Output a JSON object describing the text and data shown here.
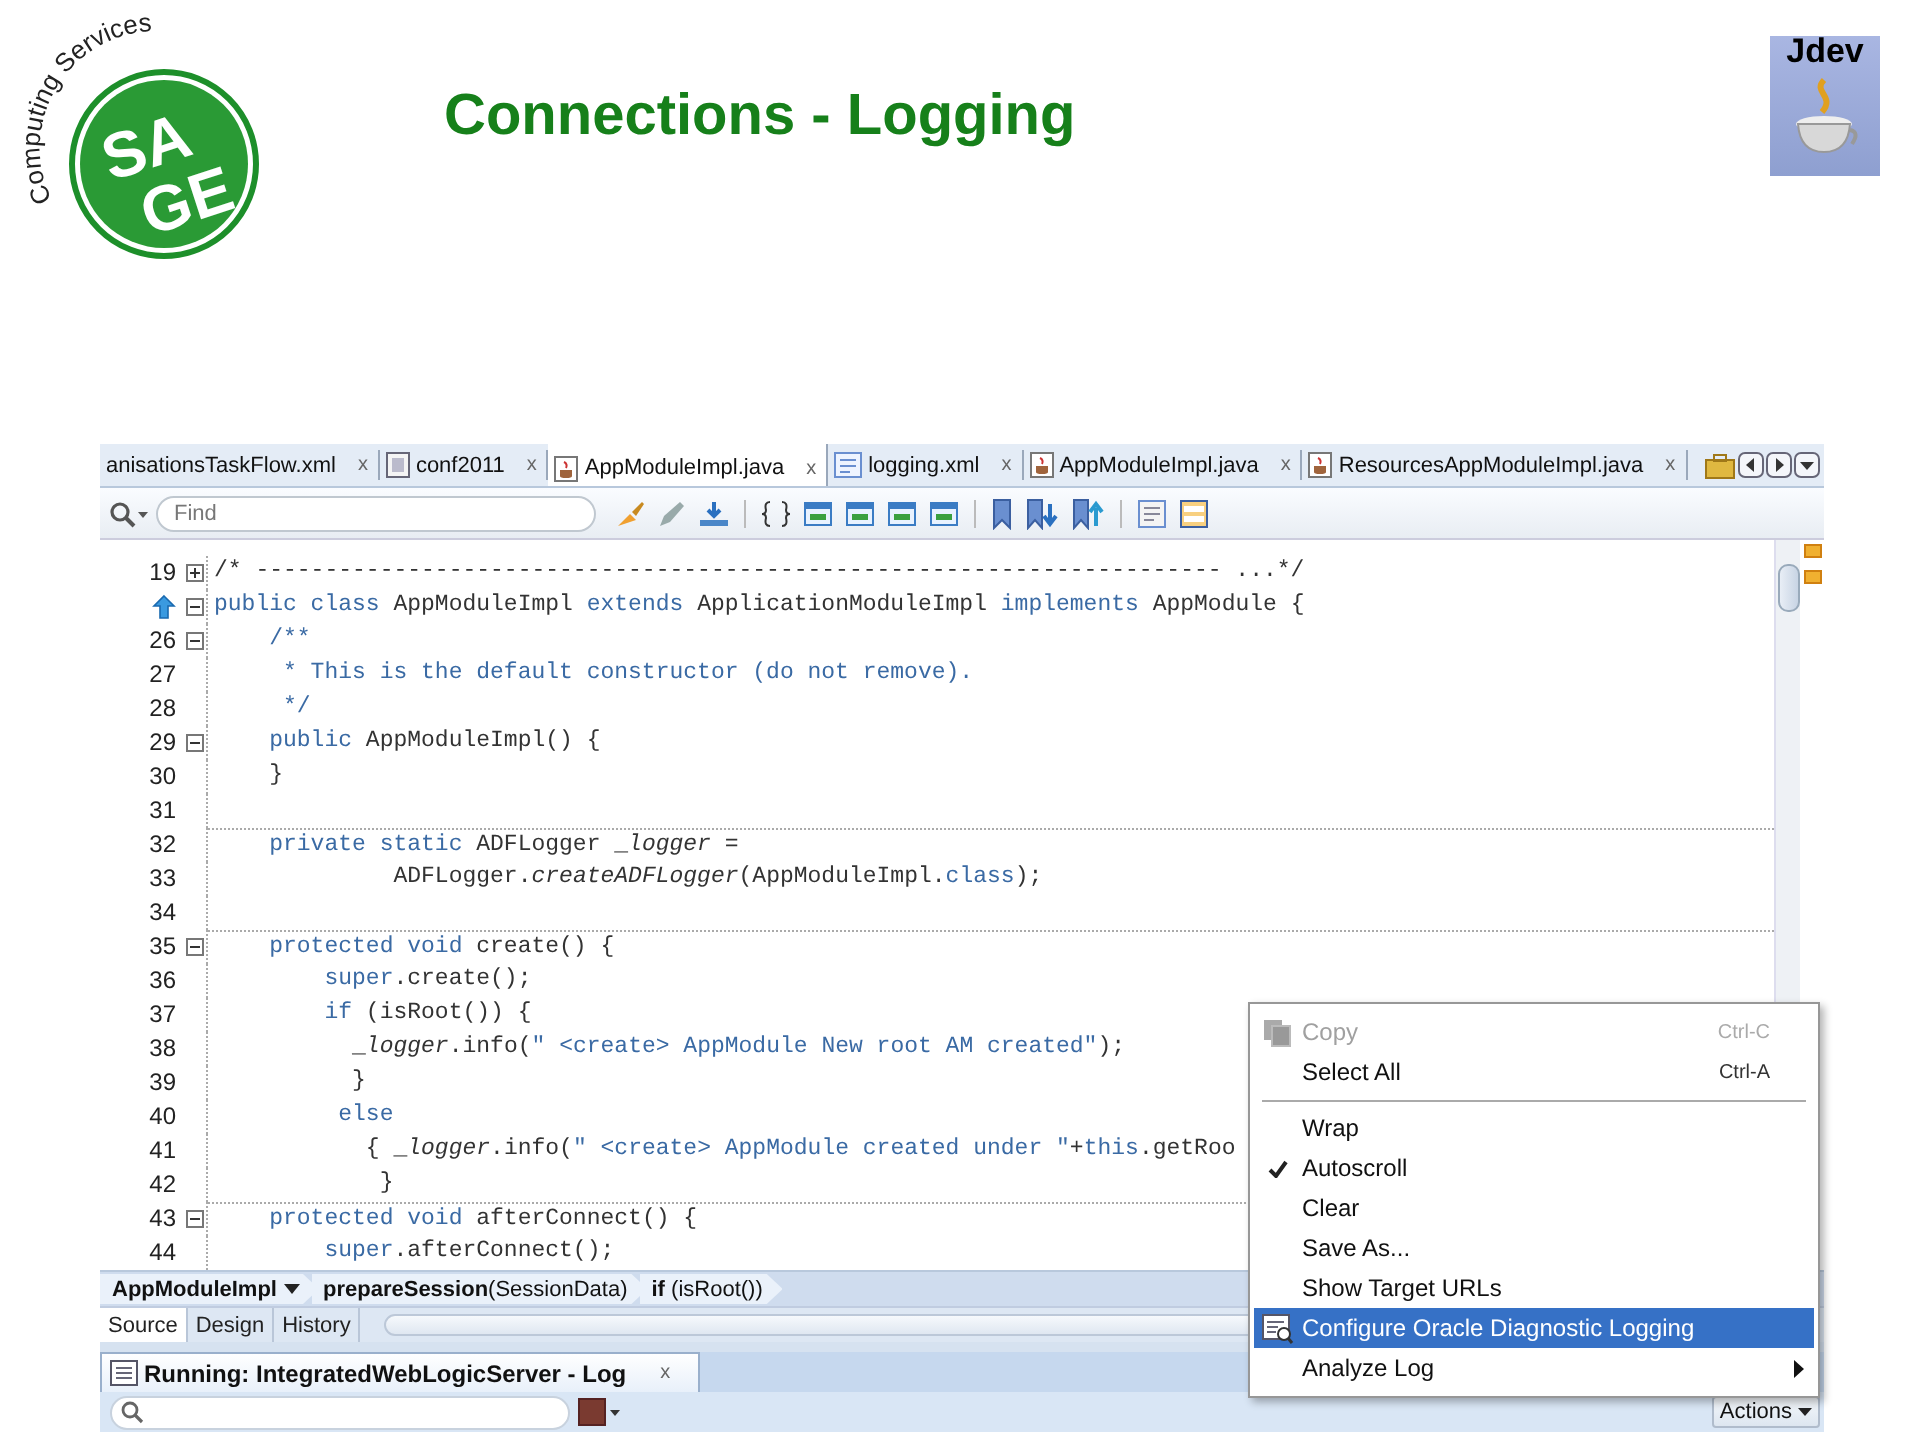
{
  "slide": {
    "title": "Connections - Logging",
    "logo": {
      "arc_text": "Computing Services",
      "top": "SA",
      "bottom": "GE"
    },
    "badge": {
      "label": "Jdev"
    }
  },
  "editor_tabs": [
    {
      "label": "anisationsTaskFlow.xml",
      "close": "x",
      "selected": false
    },
    {
      "label": "conf2011",
      "close": "x",
      "selected": false
    },
    {
      "label": "AppModuleImpl.java",
      "close": "x",
      "selected": true
    },
    {
      "label": "logging.xml",
      "close": "x",
      "selected": false
    },
    {
      "label": "AppModuleImpl.java",
      "close": "x",
      "selected": false
    },
    {
      "label": "ResourcesAppModuleImpl.java",
      "close": "x",
      "selected": false
    }
  ],
  "search": {
    "placeholder": "Find"
  },
  "code_lines": [
    {
      "number": "19",
      "kind": "collapsed",
      "separator_above": false,
      "segments": [
        {
          "kind": "plain",
          "text": "/* ---------------------------------------------------------------------- ...*/"
        }
      ]
    },
    {
      "kind": "expanded",
      "separator_above": false,
      "segments": [
        {
          "kind": "kw",
          "text": "public class "
        },
        {
          "kind": "plain",
          "text": "AppModuleImpl "
        },
        {
          "kind": "kw",
          "text": "extends "
        },
        {
          "kind": "plain",
          "text": "ApplicationModuleImpl "
        },
        {
          "kind": "kw",
          "text": "implements "
        },
        {
          "kind": "plain",
          "text": "AppModule {"
        }
      ]
    },
    {
      "number": "26",
      "kind": "expanded",
      "separator_above": false,
      "segments": [
        {
          "kind": "comment",
          "text": "    /**"
        }
      ]
    },
    {
      "number": "27",
      "kind": "plain",
      "separator_above": false,
      "segments": [
        {
          "kind": "comment",
          "text": "     * This is the default constructor (do not remove)."
        }
      ]
    },
    {
      "number": "28",
      "kind": "plain",
      "separator_above": false,
      "segments": [
        {
          "kind": "comment",
          "text": "     */"
        }
      ]
    },
    {
      "number": "29",
      "kind": "expanded",
      "separator_above": false,
      "segments": [
        {
          "kind": "kw",
          "text": "    public "
        },
        {
          "kind": "plain",
          "text": "AppModuleImpl() {"
        }
      ]
    },
    {
      "number": "30",
      "kind": "plain",
      "separator_above": false,
      "segments": [
        {
          "kind": "plain",
          "text": "    }"
        }
      ]
    },
    {
      "number": "31",
      "kind": "plain",
      "separator_above": false
    },
    {
      "number": "32",
      "kind": "plain",
      "separator_above": true,
      "segments": [
        {
          "kind": "kw",
          "text": "    private static "
        },
        {
          "kind": "plain",
          "text": "ADFLogger _"
        },
        {
          "kind": "italic",
          "text": "logger"
        },
        {
          "kind": "plain",
          "text": " ="
        }
      ]
    },
    {
      "number": "33",
      "kind": "plain",
      "separator_above": false,
      "segments": [
        {
          "kind": "plain",
          "text": "             ADFLogger."
        },
        {
          "kind": "italic",
          "text": "createADFLogger"
        },
        {
          "kind": "plain",
          "text": "(AppModuleImpl."
        },
        {
          "kind": "kw",
          "text": "class"
        },
        {
          "kind": "plain",
          "text": ");"
        }
      ]
    },
    {
      "number": "34",
      "kind": "plain",
      "separator_above": false
    },
    {
      "number": "35",
      "kind": "expanded",
      "separator_above": true,
      "segments": [
        {
          "kind": "kw",
          "text": "    protected void "
        },
        {
          "kind": "plain",
          "text": "create() {"
        }
      ]
    },
    {
      "number": "36",
      "kind": "plain",
      "separator_above": false,
      "segments": [
        {
          "kind": "kw",
          "text": "        super"
        },
        {
          "kind": "plain",
          "text": ".create();"
        }
      ]
    },
    {
      "number": "37",
      "kind": "plain",
      "separator_above": false,
      "segments": [
        {
          "kind": "kw",
          "text": "        if "
        },
        {
          "kind": "plain",
          "text": "(isRoot()) {"
        }
      ]
    },
    {
      "number": "38",
      "kind": "plain",
      "separator_above": false,
      "segments": [
        {
          "kind": "plain",
          "text": "          _"
        },
        {
          "kind": "italic",
          "text": "logger"
        },
        {
          "kind": "plain",
          "text": ".info("
        },
        {
          "kind": "string",
          "text": "\" <create> AppModule New root AM created\""
        },
        {
          "kind": "plain",
          "text": ");"
        }
      ]
    },
    {
      "number": "39",
      "kind": "plain",
      "separator_above": false,
      "segments": [
        {
          "kind": "plain",
          "text": "          }"
        }
      ]
    },
    {
      "number": "40",
      "kind": "plain",
      "separator_above": false,
      "segments": [
        {
          "kind": "kw",
          "text": "         else"
        }
      ]
    },
    {
      "number": "41",
      "kind": "plain",
      "separator_above": false,
      "segments": [
        {
          "kind": "plain",
          "text": "           { _"
        },
        {
          "kind": "italic",
          "text": "logger"
        },
        {
          "kind": "plain",
          "text": ".info("
        },
        {
          "kind": "string",
          "text": "\" <create> AppModule created under \""
        },
        {
          "kind": "plain",
          "text": "+"
        },
        {
          "kind": "kw",
          "text": "this"
        },
        {
          "kind": "plain",
          "text": ".getRoo"
        }
      ]
    },
    {
      "number": "42",
      "kind": "plain",
      "separator_above": false,
      "segments": [
        {
          "kind": "plain",
          "text": "            }"
        }
      ]
    },
    {
      "number": "43",
      "kind": "expanded",
      "separator_above": true,
      "segments": [
        {
          "kind": "kw",
          "text": "    protected void "
        },
        {
          "kind": "plain",
          "text": "afterConnect() {"
        }
      ]
    },
    {
      "number": "44",
      "kind": "plain",
      "separator_above": false,
      "segments": [
        {
          "kind": "kw",
          "text": "        super"
        },
        {
          "kind": "plain",
          "text": ".afterConnect();"
        }
      ]
    }
  ],
  "breadcrumb": [
    {
      "text": "AppModuleImpl",
      "dropdown": true
    },
    {
      "text": "**prepareSession**(SessionData)",
      "dropdown": false
    },
    {
      "text": "**if** (isRoot())",
      "dropdown": false
    }
  ],
  "view_tabs": [
    {
      "label": "Source",
      "selected": true
    },
    {
      "label": "Design",
      "selected": false
    },
    {
      "label": "History",
      "selected": false
    }
  ],
  "log": {
    "title": "Running: IntegratedWebLogicServer - Log",
    "close": "x",
    "actions": "Actions"
  },
  "context_menu": [
    {
      "kind": "item",
      "label": "Copy",
      "shortcut": "Ctrl-C",
      "disabled": true,
      "checked": false,
      "selected": false,
      "submenu": false
    },
    {
      "kind": "item",
      "label": "Select All",
      "shortcut": "Ctrl-A",
      "disabled": false,
      "checked": false,
      "selected": false,
      "submenu": false
    },
    {
      "kind": "separator"
    },
    {
      "kind": "item",
      "label": "Wrap",
      "disabled": false,
      "checked": false,
      "selected": false,
      "submenu": false
    },
    {
      "kind": "item",
      "label": "Autoscroll",
      "disabled": false,
      "checked": true,
      "selected": false,
      "submenu": false
    },
    {
      "kind": "item",
      "label": "Clear",
      "disabled": false,
      "checked": false,
      "selected": false,
      "submenu": false
    },
    {
      "kind": "item",
      "label": "Save As...",
      "disabled": false,
      "checked": false,
      "selected": false,
      "submenu": false
    },
    {
      "kind": "item",
      "label": "Show Target URLs",
      "disabled": false,
      "checked": false,
      "selected": false,
      "submenu": false
    },
    {
      "kind": "item",
      "label": "Configure Oracle Diagnostic Logging",
      "disabled": false,
      "checked": false,
      "selected": true,
      "submenu": false
    },
    {
      "kind": "item",
      "label": "Analyze Log",
      "disabled": false,
      "checked": false,
      "selected": false,
      "submenu": true
    }
  ]
}
